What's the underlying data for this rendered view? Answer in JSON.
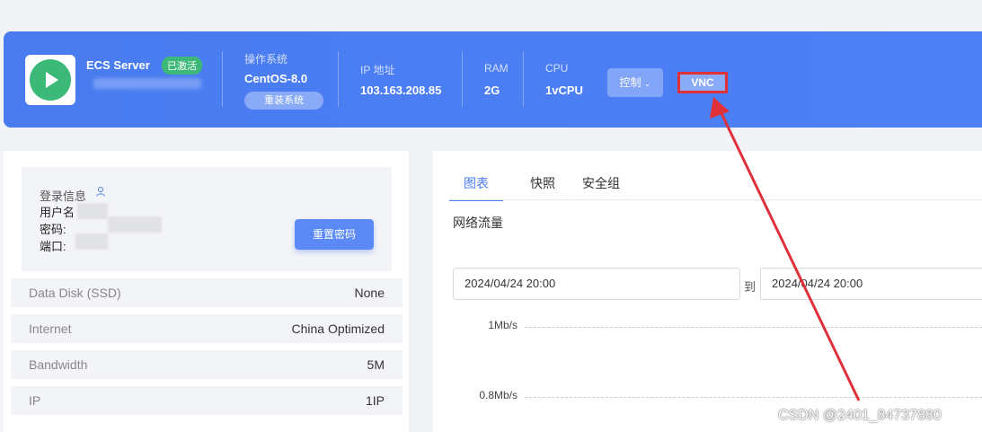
{
  "server": {
    "name": "ECS Server",
    "status_badge": "已激活",
    "os_label": "操作系统",
    "os_value": "CentOS-8.0",
    "reinstall_label": "重装系统",
    "ip_label": "IP 地址",
    "ip_value": "103.163.208.85",
    "ram_label": "RAM",
    "ram_value": "2G",
    "cpu_label": "CPU",
    "cpu_value": "1vCPU",
    "control_label": "控制",
    "vnc_label": "VNC"
  },
  "login": {
    "title": "登录信息",
    "username_label": "用户名",
    "password_label": "密码:",
    "port_label": "端口:",
    "reset_label": "重置密码"
  },
  "specs": [
    {
      "key": "Data Disk (SSD)",
      "value": "None"
    },
    {
      "key": "Internet",
      "value": "China Optimized"
    },
    {
      "key": "Bandwidth",
      "value": "5M"
    },
    {
      "key": "IP",
      "value": "1IP"
    }
  ],
  "tabs": [
    "图表",
    "快照",
    "安全组"
  ],
  "traffic": {
    "title": "网络流量",
    "start_date": "2024/04/24 20:00",
    "to_label": "到",
    "end_date": "2024/04/24 20:00",
    "y_ticks": [
      "1Mb/s",
      "0.8Mb/s"
    ]
  },
  "watermark": "CSDN @2401_84737880",
  "colors": {
    "banner": "#4a7cf0",
    "active": "#3cb878",
    "highlight": "#e0313b"
  },
  "icons": [
    "play-icon",
    "user-icon",
    "chevron-down-icon"
  ]
}
